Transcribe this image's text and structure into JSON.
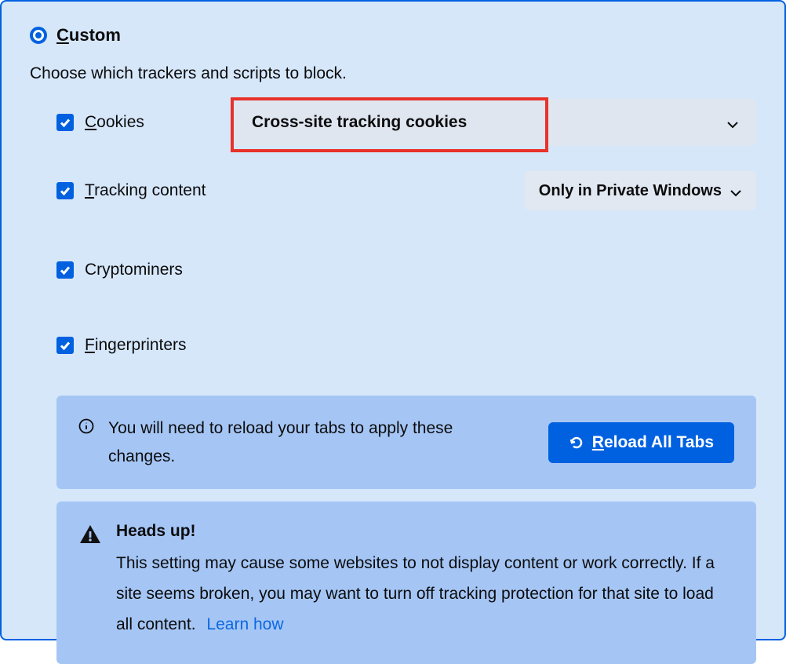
{
  "header": {
    "radio_label_html": "<span class='u'>C</span>ustom"
  },
  "description": "Choose which trackers and scripts to block.",
  "options": {
    "cookies": {
      "label_html": "<span class='u'>C</span>ookies",
      "checked": true,
      "dropdown_value": "Cross-site tracking cookies"
    },
    "tracking_content": {
      "label_html": "<span class='u'>T</span>racking content",
      "checked": true,
      "dropdown_value": "Only in Private Windows"
    },
    "cryptominers": {
      "label_html": "Cryptominers",
      "checked": true
    },
    "fingerprinters": {
      "label_html": "<span class='u'>F</span>ingerprinters",
      "checked": true
    }
  },
  "info_banner": {
    "text": "You will need to reload your tabs to apply these changes.",
    "button_html": "<span class='u'>R</span>eload All Tabs"
  },
  "warning_banner": {
    "title": "Heads up!",
    "text": "This setting may cause some websites to not display content or work correctly. If a site seems broken, you may want to turn off tracking protection for that site to load all content.",
    "link": "Learn how"
  },
  "colors": {
    "accent": "#0061E0",
    "highlight": "#E8322A",
    "panel_bg": "#D6E7FA",
    "banner_bg": "#A5C6F5"
  }
}
